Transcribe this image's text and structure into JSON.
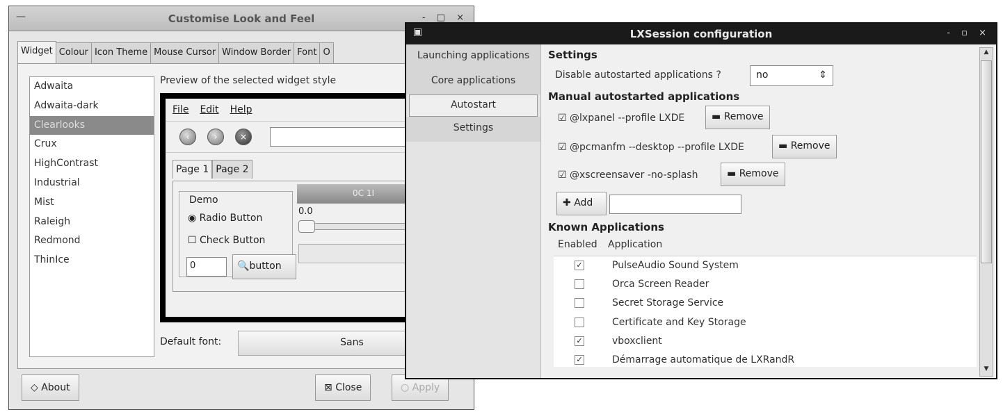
{
  "left_window": {
    "title": "Customise Look and Feel",
    "menu_glyph": "—",
    "wm_buttons": "- □ ×",
    "tabs": [
      "Widget",
      "Colour",
      "Icon Theme",
      "Mouse Cursor",
      "Window Border",
      "Font",
      "O"
    ],
    "themes": [
      "Adwaita",
      "Adwaita-dark",
      "Clearlooks",
      "Crux",
      "HighContrast",
      "Industrial",
      "Mist",
      "Raleigh",
      "Redmond",
      "ThinIce"
    ],
    "selected_theme": "Clearlooks",
    "preview_label": "Preview of the selected widget style",
    "preview": {
      "menu": [
        "File",
        "Edit",
        "Help"
      ],
      "tabs": [
        "Page 1",
        "Page 2"
      ],
      "demo_label": "Demo",
      "radio_label": "Radio Button",
      "check_label": "Check Button",
      "spin_value": "0",
      "button_label": "button",
      "scale_value": "0.0",
      "scale_header": "0C 1I"
    },
    "default_font_label": "Default font:",
    "default_font_value": "Sans",
    "about_label": "About",
    "close_label": "Close",
    "apply_label": "Apply"
  },
  "right_window": {
    "title": "LXSession configuration",
    "wm_buttons": "- ▫ ×",
    "nav": [
      "Launching applications",
      "Core applications",
      "Autostart",
      "Settings"
    ],
    "settings_heading": "Settings",
    "disable_label": "Disable autostarted applications ?",
    "disable_value": "no",
    "manual_heading": "Manual autostarted applications",
    "manual_items": [
      {
        "label": "@lxpanel --profile LXDE",
        "checked": "☑",
        "remove": "Remove"
      },
      {
        "label": "@pcmanfm --desktop --profile LXDE",
        "checked": "☑",
        "remove": "Remove"
      },
      {
        "label": "@xscreensaver -no-splash",
        "checked": "☑",
        "remove": "Remove"
      }
    ],
    "add_label": "Add",
    "known_heading": "Known Applications",
    "col_enabled": "Enabled",
    "col_application": "Application",
    "known_apps": [
      {
        "name": "PulseAudio Sound System",
        "mark": "✓"
      },
      {
        "name": "Orca Screen Reader",
        "mark": ""
      },
      {
        "name": "Secret Storage Service",
        "mark": ""
      },
      {
        "name": "Certificate and Key Storage",
        "mark": ""
      },
      {
        "name": "vboxclient",
        "mark": "✓"
      },
      {
        "name": "Démarrage automatique de LXRandR",
        "mark": "✓"
      }
    ]
  }
}
